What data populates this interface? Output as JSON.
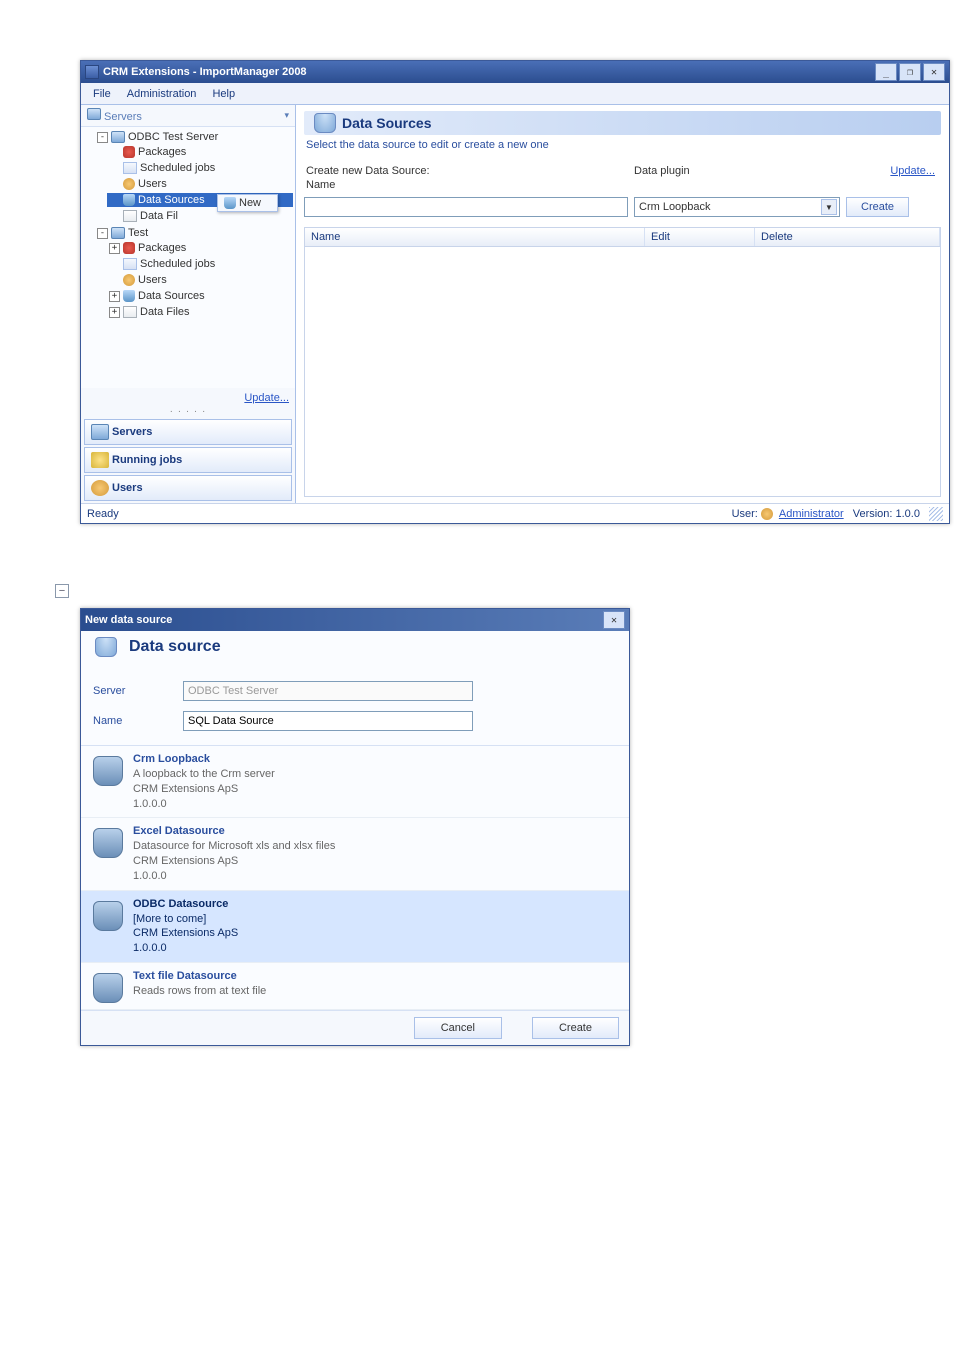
{
  "window": {
    "title": "CRM Extensions - ImportManager 2008",
    "controls": {
      "min": "_",
      "max": "❐",
      "close": "✕"
    }
  },
  "menubar": [
    "File",
    "Administration",
    "Help"
  ],
  "sidebar": {
    "header": "Servers",
    "tree": [
      {
        "label": "ODBC Test Server",
        "exp": "-",
        "children": [
          {
            "label": "Packages",
            "icon": "pkg"
          },
          {
            "label": "Scheduled jobs",
            "icon": "sched"
          },
          {
            "label": "Users",
            "icon": "users"
          },
          {
            "label": "Data Sources",
            "icon": "ds",
            "selected": true,
            "ctx": {
              "icon": "ds",
              "label": "New"
            }
          },
          {
            "label": "Data Fil",
            "icon": "df"
          }
        ]
      },
      {
        "label": "Test",
        "exp": "-",
        "children": [
          {
            "label": "Packages",
            "icon": "pkg",
            "exp": "+"
          },
          {
            "label": "Scheduled jobs",
            "icon": "sched"
          },
          {
            "label": "Users",
            "icon": "users"
          },
          {
            "label": "Data Sources",
            "icon": "ds",
            "exp": "+"
          },
          {
            "label": "Data Files",
            "icon": "df",
            "exp": "+"
          }
        ]
      }
    ],
    "update_link": "Update...",
    "nav": [
      {
        "label": "Servers",
        "icon": "server"
      },
      {
        "label": "Running jobs",
        "icon": "run"
      },
      {
        "label": "Users",
        "icon": "users"
      }
    ]
  },
  "content": {
    "title": "Data Sources",
    "subtitle": "Select the data source to edit or create a new one",
    "form": {
      "create_label": "Create new Data Source:",
      "name_label": "Name",
      "name_value": "",
      "plugin_label": "Data plugin",
      "plugin_value": "Crm Loopback",
      "update_link": "Update...",
      "create_btn": "Create"
    },
    "grid": {
      "cols": [
        "Name",
        "Edit",
        "Delete"
      ]
    }
  },
  "status": {
    "ready": "Ready",
    "user_label": "User:",
    "user": "Administrator",
    "ver_label": "Version:",
    "ver": "1.0.0"
  },
  "collapse": "−",
  "dialog": {
    "title": "New data source",
    "header": "Data source",
    "server_label": "Server",
    "server_value": "ODBC Test Server",
    "name_label": "Name",
    "name_value": "SQL Data Source",
    "items": [
      {
        "name": "Crm Loopback",
        "desc": "A loopback to the Crm server",
        "vendor": "CRM Extensions ApS",
        "ver": "1.0.0.0",
        "sel": false
      },
      {
        "name": "Excel Datasource",
        "desc": "Datasource for Microsoft xls and xlsx files",
        "vendor": "CRM Extensions ApS",
        "ver": "1.0.0.0",
        "sel": false
      },
      {
        "name": "ODBC Datasource",
        "desc": "[More to come]",
        "vendor": "CRM Extensions ApS",
        "ver": "1.0.0.0",
        "sel": true
      },
      {
        "name": "Text file Datasource",
        "desc": "Reads rows from at text file",
        "vendor": "",
        "ver": "",
        "sel": false
      }
    ],
    "cancel": "Cancel",
    "create": "Create"
  }
}
